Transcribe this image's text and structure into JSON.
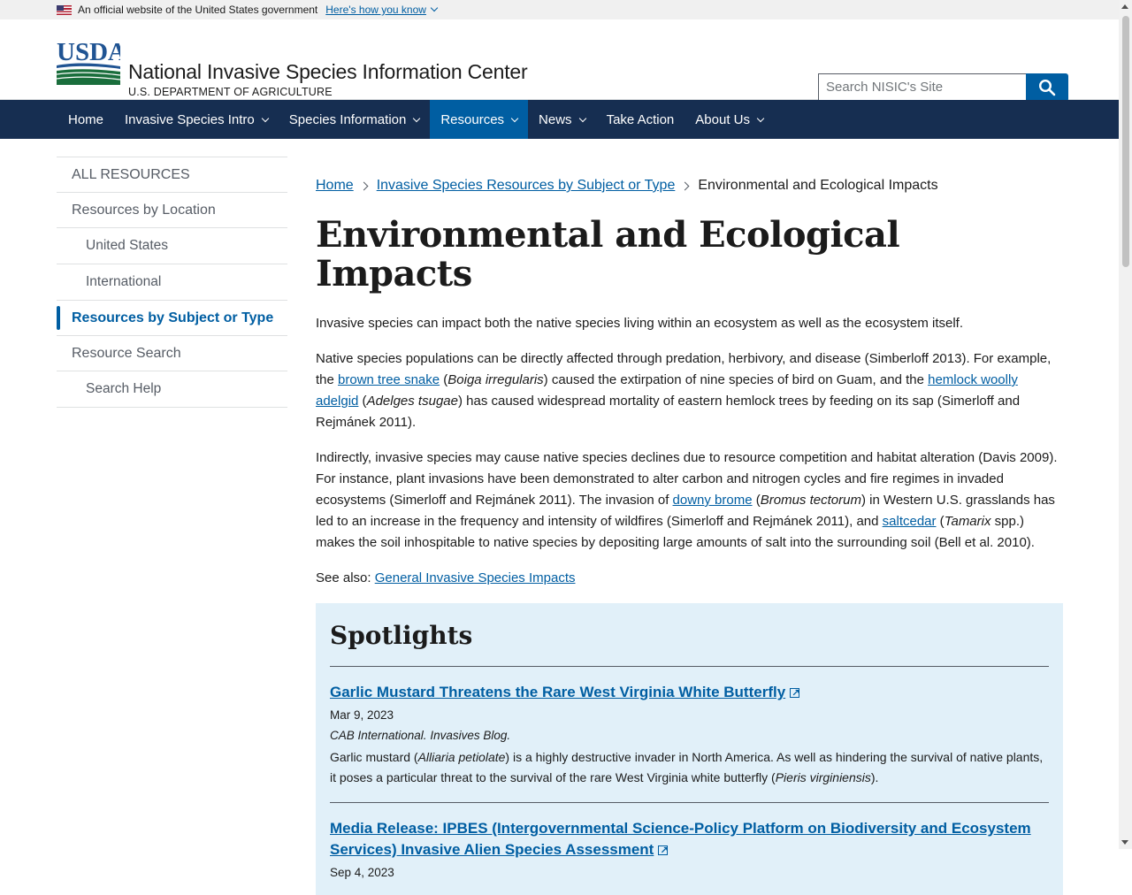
{
  "banner": {
    "text": "An official website of the United States government",
    "link": "Here's how you know"
  },
  "header": {
    "logo_text": "USDA",
    "title": "National Invasive Species Information Center",
    "subtitle": "U.S. DEPARTMENT OF AGRICULTURE",
    "search_placeholder": "Search NISIC's Site"
  },
  "nav": {
    "items": [
      {
        "label": "Home"
      },
      {
        "label": "Invasive Species Intro"
      },
      {
        "label": "Species Information"
      },
      {
        "label": "Resources"
      },
      {
        "label": "News"
      },
      {
        "label": "Take Action"
      },
      {
        "label": "About Us"
      }
    ]
  },
  "sidebar": {
    "items": [
      {
        "label": "ALL RESOURCES"
      },
      {
        "label": "Resources by Location"
      },
      {
        "label": "United States"
      },
      {
        "label": "International"
      },
      {
        "label": "Resources by Subject or Type"
      },
      {
        "label": "Resource Search"
      },
      {
        "label": "Search Help"
      }
    ]
  },
  "breadcrumb": {
    "home": "Home",
    "parent": "Invasive Species Resources by Subject or Type",
    "current": "Environmental and Ecological Impacts"
  },
  "page": {
    "title": "Environmental and Ecological Impacts",
    "p1": "Invasive species can impact both the native species living within an ecosystem as well as the ecosystem itself.",
    "p2": {
      "a": "Native species populations can be directly affected through predation, herbivory, and disease (Simberloff 2013). For example, the ",
      "link1": "brown tree snake",
      "b": " (",
      "sci1": "Boiga irregularis",
      "c": ") caused the extirpation of nine species of bird on Guam, and the ",
      "link2": "hemlock woolly adelgid",
      "d": " (",
      "sci2": "Adelges tsugae",
      "e": ") has caused widespread mortality of eastern hemlock trees by feeding on its sap (Simerloff and Rejmánek 2011)."
    },
    "p3": {
      "a": "Indirectly, invasive species may cause native species declines due to resource competition and habitat alteration (Davis 2009). For instance, plant invasions have been demonstrated to alter carbon and nitrogen cycles and fire regimes in invaded ecosystems (Simerloff and Rejmánek 2011). The invasion of ",
      "link1": "downy brome",
      "b": " (",
      "sci1": "Bromus tectorum",
      "c": ") in Western U.S. grasslands has led to an increase in the frequency and intensity of wildfires (Simerloff and Rejmánek 2011), and ",
      "link2": "saltcedar",
      "d": " (",
      "sci2": "Tamarix",
      "e": " spp.) makes the soil inhospitable to native species by depositing large amounts of salt into the surrounding soil (Bell et al. 2010)."
    },
    "see_also_label": "See also: ",
    "see_also_link": "General Invasive Species Impacts"
  },
  "spotlights": {
    "heading": "Spotlights",
    "items": [
      {
        "title": "Garlic Mustard Threatens the Rare West Virginia White Butterfly",
        "date": "Mar 9, 2023",
        "source": "CAB International. Invasives Blog.",
        "desc_a": "Garlic mustard (",
        "desc_sci1": "Alliaria petiolate",
        "desc_b": ") is a highly destructive invader in North America. As well as hindering the survival of native plants, it poses a particular threat to the survival of the rare West Virginia white butterfly (",
        "desc_sci2": "Pieris virginiensis",
        "desc_c": ")."
      },
      {
        "title": "Media Release: IPBES (Intergovernmental Science-Policy Platform on Biodiversity and Ecosystem Services) Invasive Alien Species Assessment",
        "date": "Sep 4, 2023"
      }
    ]
  },
  "colors": {
    "nav_bg": "#162e51",
    "accent": "#005ea2",
    "spotlight_bg": "#e1f0f9",
    "usda_green": "#205493"
  }
}
